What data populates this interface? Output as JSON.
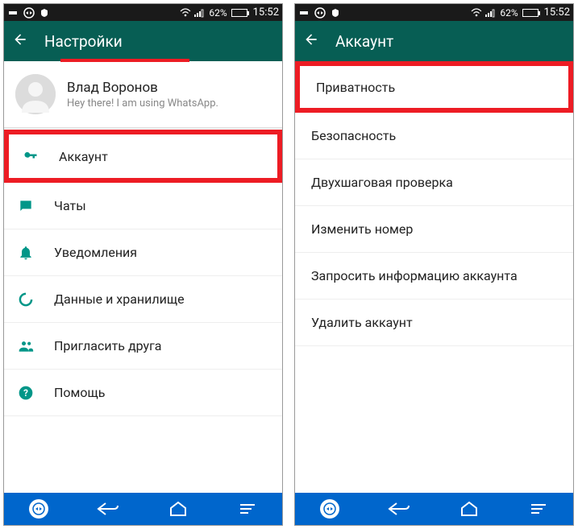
{
  "status": {
    "battery_pct": "62%",
    "time": "15:52"
  },
  "left": {
    "title": "Настройки",
    "profile": {
      "name": "Влад Воронов",
      "status": "Hey there! I am using WhatsApp."
    },
    "items": {
      "account": "Аккаунт",
      "chats": "Чаты",
      "notifications": "Уведомления",
      "data": "Данные и хранилище",
      "invite": "Пригласить друга",
      "help": "Помощь"
    }
  },
  "right": {
    "title": "Аккаунт",
    "items": {
      "privacy": "Приватность",
      "security": "Безопасность",
      "two_step": "Двухшаговая проверка",
      "change_number": "Изменить номер",
      "request_info": "Запросить информацию аккаунта",
      "delete": "Удалить аккаунт"
    }
  },
  "colors": {
    "teal": "#075e54",
    "accent": "#00a884",
    "nav_blue": "#0066cc",
    "highlight": "#ed1c24"
  }
}
